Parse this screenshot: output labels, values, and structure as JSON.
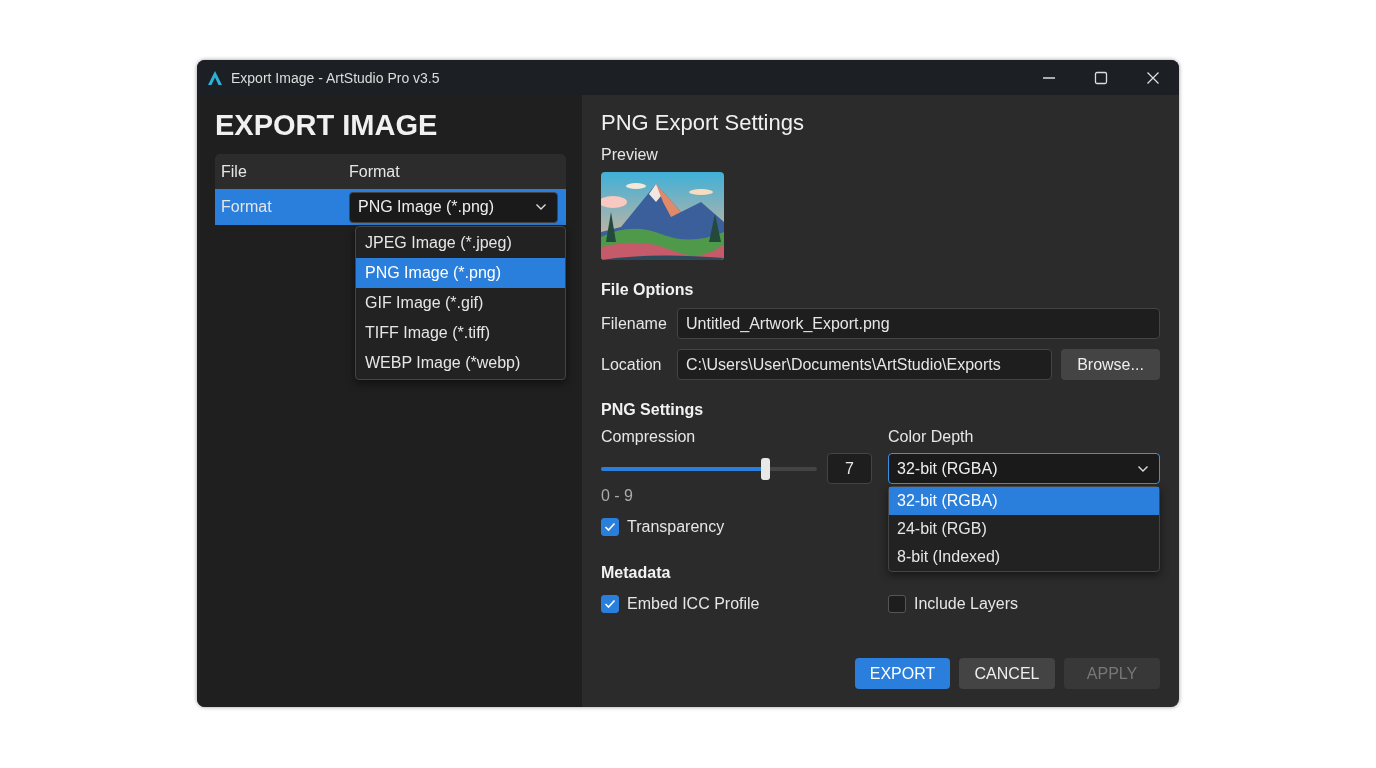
{
  "window": {
    "title": "Export Image - ArtStudio Pro v3.5"
  },
  "left": {
    "heading": "EXPORT IMAGE",
    "table": {
      "columns": [
        "File",
        "Format"
      ],
      "rows": [
        {
          "label": "Format",
          "selected": true,
          "value": "PNG Image (*.png)"
        }
      ]
    },
    "format_menu": [
      {
        "label": "JPEG Image (*.jpeg)",
        "selected": false
      },
      {
        "label": "PNG Image (*.png)",
        "selected": true
      },
      {
        "label": "GIF Image (*.gif)",
        "selected": false
      },
      {
        "label": "TIFF Image (*.tiff)",
        "selected": false
      },
      {
        "label": "WEBP Image (*webp)",
        "selected": false
      }
    ]
  },
  "settings": {
    "heading": "PNG Export Settings",
    "preview_label": "Preview",
    "file_options": {
      "heading": "File Options",
      "filename_label": "Filename",
      "filename": "Untitled_Artwork_Export.png",
      "location_label": "Location",
      "location": "C:\\Users\\User\\Documents\\ArtStudio\\Exports",
      "browse": "Browse..."
    },
    "png_settings": {
      "heading": "PNG Settings",
      "compression_label": "Compression",
      "compression": {
        "level": 0.76,
        "value": "7"
      },
      "range": "0 - 9",
      "color_depth_label": "Color Depth",
      "color_depth": "32-bit (RGBA)",
      "color_depth_menu": [
        {
          "label": "32-bit (RGBA)",
          "selected": true
        },
        {
          "label": "24-bit (RGB)",
          "selected": false
        },
        {
          "label": "8-bit (Indexed)",
          "selected": false
        }
      ],
      "transparency": {
        "label": "Transparency",
        "checked": true
      }
    },
    "metadata": {
      "heading": "Metadata",
      "options": [
        {
          "label": "Embed ICC Profile",
          "checked": true
        },
        {
          "label": "Include Layers",
          "checked": false
        }
      ]
    },
    "buttons": [
      {
        "label": "EXPORT",
        "kind": "primary",
        "disabled": false
      },
      {
        "label": "CANCEL",
        "kind": "secondary",
        "disabled": false
      },
      {
        "label": "APPLY",
        "kind": "secondary",
        "disabled": true
      }
    ]
  }
}
